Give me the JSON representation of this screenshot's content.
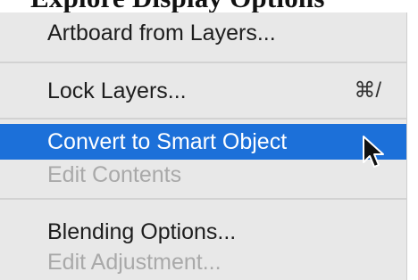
{
  "header_clip": {
    "text": "Explore Display Options"
  },
  "menu": {
    "items": [
      {
        "label": "Artboard from Layers...",
        "state": "normal"
      },
      {
        "label": "Lock Layers...",
        "shortcut": "⌘/",
        "state": "normal"
      },
      {
        "label": "Convert to Smart Object",
        "state": "selected"
      },
      {
        "label": "Edit Contents",
        "state": "disabled"
      },
      {
        "label": "Blending Options...",
        "state": "normal"
      },
      {
        "label": "Edit Adjustment...",
        "state": "disabled"
      }
    ]
  },
  "colors": {
    "menu_background": "#e8e8e8",
    "selection": "#1c70d9",
    "disabled_text": "#a9a9a9",
    "text": "#1d1d1d"
  },
  "icons": {
    "cursor": "arrow-pointer-icon"
  }
}
